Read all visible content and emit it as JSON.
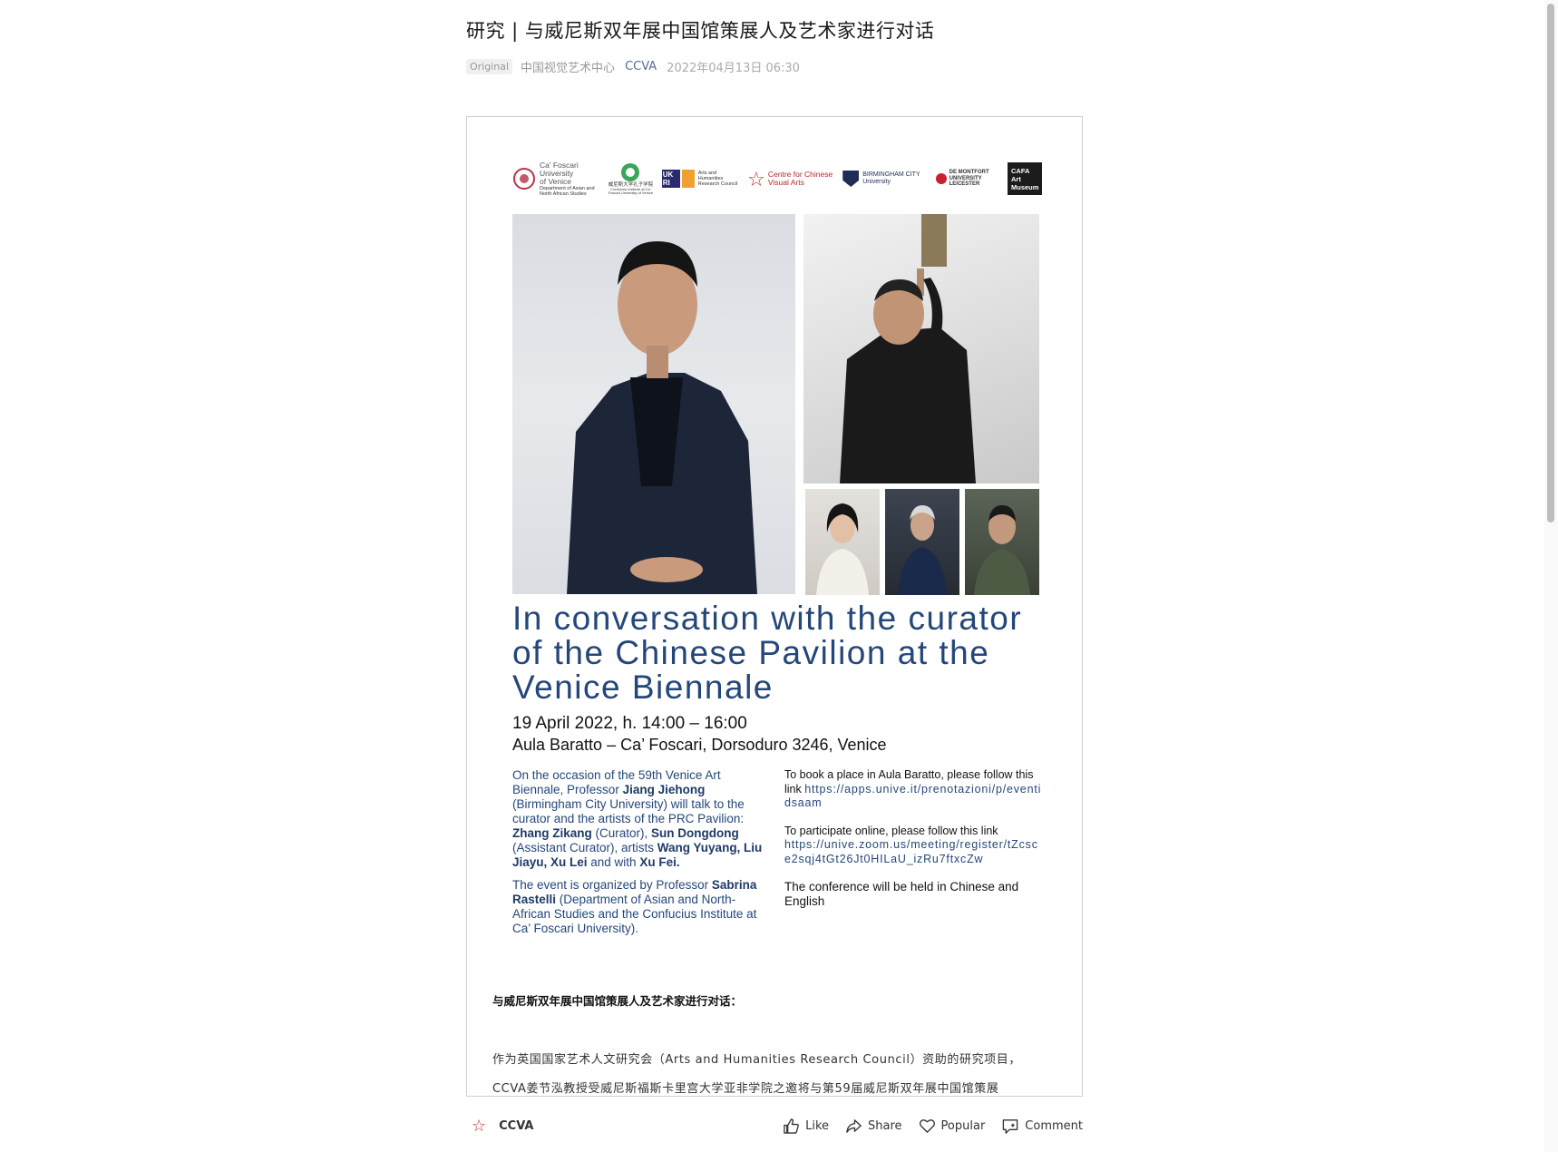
{
  "article": {
    "title": "研究 | 与威尼斯双年展中国馆策展人及艺术家进行对话",
    "badge": "Original",
    "account": "中国视觉艺术中心",
    "brand": "CCVA",
    "date": "2022年04月13日 06:30"
  },
  "poster": {
    "logos": {
      "ca_foscari": "Ca' Foscari University of Venice",
      "ca_foscari_sub": "Department of Asian and North African Studies",
      "confucius": "威尼斯大学孔子学院",
      "confucius_sub": "Confucius Institute at Ca' Foscari University of Venice",
      "ukri": "UK RI",
      "ahrc": "Arts and Humanities Research Council",
      "ccva": "Centre for Chinese Visual Arts",
      "bcu": "BIRMINGHAM CITY University",
      "dmu": "DE MONTFORT UNIVERSITY LEICESTER",
      "cafa": "CAFA Art Museum"
    },
    "headline": "In conversation with the curator of the Chinese Pavilion at the Venice Biennale",
    "date_line": "19 April 2022,  h. 14:00 – 16:00",
    "venue": "Aula Baratto – Ca’ Foscari, Dorsoduro 3246, Venice",
    "left": {
      "p1_a": "On the occasion of the 59th Venice Art Biennale, Professor ",
      "p1_b": "Jiang Jiehong",
      "p1_c": " (Birmingham City University) will talk to the curator and the artists of the PRC Pavilion: ",
      "p1_d": "Zhang Zikang",
      "p1_e": " (Curator), ",
      "p1_f": "Sun Dongdong",
      "p1_g": " (Assistant Curator), artists ",
      "p1_h": "Wang Yuyang, Liu Jiayu, Xu Lei",
      "p1_i": " and with ",
      "p1_j": "Xu Fei.",
      "p2_a": "The event is organized by Professor ",
      "p2_b": "Sabrina Rastelli",
      "p2_c": " (Department of Asian and North-African Studies and the Confucius Institute at Ca’ Foscari University)."
    },
    "right": {
      "book_text": "To book a place in Aula Baratto, please follow this link ",
      "book_link": "https://apps.unive.it/prenotazioni/p/eventidsaam",
      "online_text": "To participate online, please follow this link",
      "online_link": "https://unive.zoom.us/meeting/register/tZcsce2sqj4tGt26Jt0HILaU_izRu7ftxcZw",
      "language": "The conference will be held in Chinese and English"
    }
  },
  "body": {
    "cn_heading": "与威尼斯双年展中国馆策展人及艺术家进行对话：",
    "cn_para_1": "作为英国国家艺术人文研究会（Arts and Humanities Research Council）资助的研究项目，",
    "cn_para_2": "CCVA姜节泓教授受威尼斯福斯卡里宫大学亚非学院之邀将与第59届威尼斯双年展中国馆策展"
  },
  "footer": {
    "account_icon": "star-icon",
    "account_name": "CCVA",
    "like": "Like",
    "share": "Share",
    "popular": "Popular",
    "comment": "Comment"
  },
  "colors": {
    "poster_blue": "#24477a",
    "link_blue": "#576b95",
    "star_red": "#c72c2c"
  }
}
